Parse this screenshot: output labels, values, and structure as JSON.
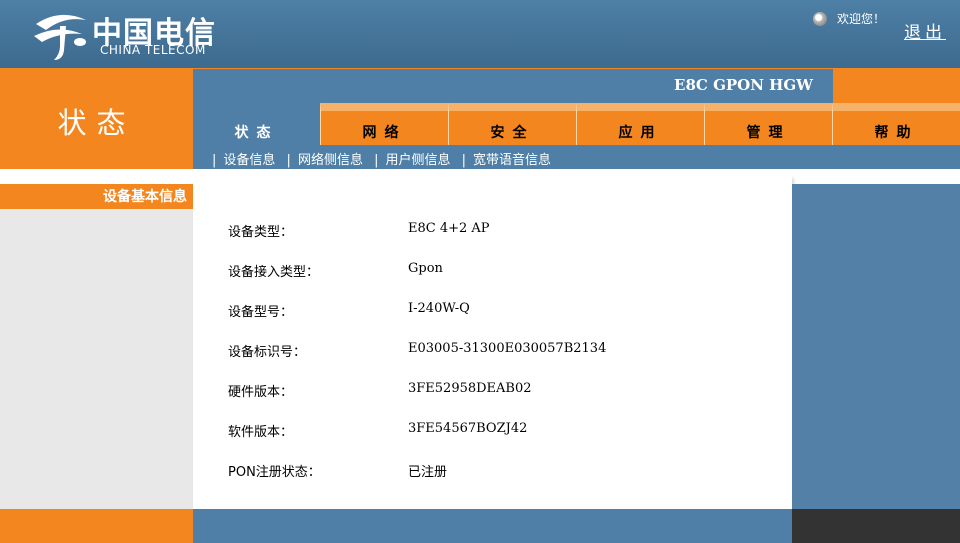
{
  "header": {
    "logo_cn": "中国电信",
    "logo_en": "CHINA TELECOM",
    "welcome": "欢迎您！",
    "logout": "退出"
  },
  "sidebar": {
    "title": "状态",
    "section": "设备基本信息"
  },
  "product": {
    "name": "E8C GPON HGW"
  },
  "tabs": [
    {
      "label": "状态",
      "active": true
    },
    {
      "label": "网络",
      "active": false
    },
    {
      "label": "安全",
      "active": false
    },
    {
      "label": "应用",
      "active": false
    },
    {
      "label": "管理",
      "active": false
    },
    {
      "label": "帮助",
      "active": false
    }
  ],
  "subnav": [
    {
      "label": "设备信息"
    },
    {
      "label": "网络侧信息"
    },
    {
      "label": "用户侧信息"
    },
    {
      "label": "宽带语音信息"
    }
  ],
  "info": [
    {
      "label": "设备类型：",
      "value": "E8C 4+2 AP"
    },
    {
      "label": "设备接入类型：",
      "value": "Gpon"
    },
    {
      "label": "设备型号：",
      "value": "I-240W-Q"
    },
    {
      "label": "设备标识号：",
      "value": "E03005-31300E030057B2134"
    },
    {
      "label": "硬件版本：",
      "value": "3FE52958DEAB02"
    },
    {
      "label": "软件版本：",
      "value": "3FE54567BOZJ42"
    },
    {
      "label": "PON注册状态：",
      "value": "已注册"
    }
  ],
  "colors": {
    "brand_orange": "#f3861e",
    "brand_blue": "#4f7fa6",
    "header_blue": "#4e7fa5"
  }
}
